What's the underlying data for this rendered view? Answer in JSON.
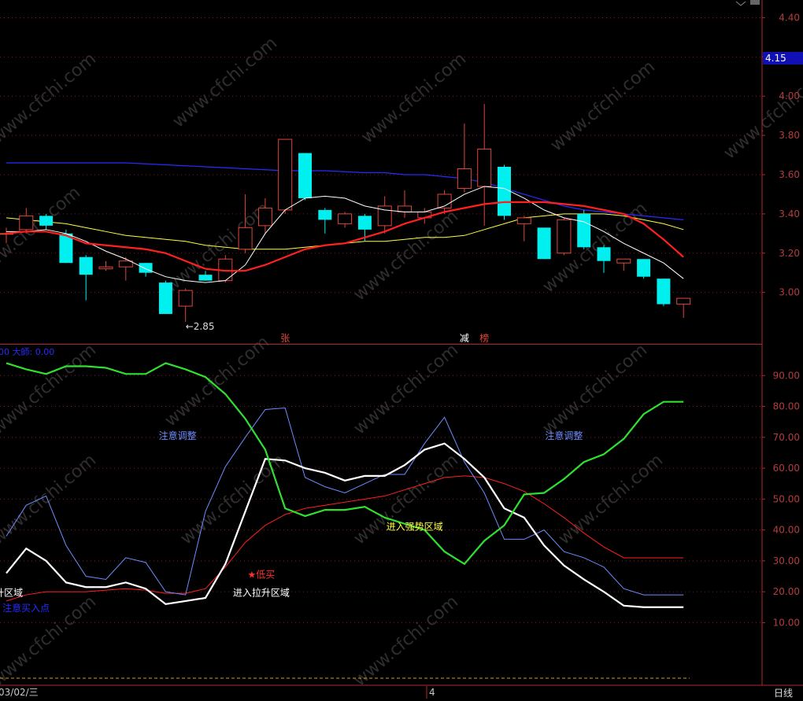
{
  "colors": {
    "up": "#e0463c",
    "down": "#00f0f0",
    "ma5": "#ffffff",
    "ma10": "#ffff40",
    "ma20": "#ff2020",
    "ma60": "#2a2aff",
    "axis": "#b4282d",
    "grid": "#7a1a1a",
    "osc_fast": "#ffffff",
    "osc_blue": "#6e8cff",
    "osc_red": "#ff2020",
    "osc_green": "#30e030"
  },
  "price_panel": {
    "price_marker_label": "4.15",
    "low_annotation": "←2.85",
    "markers": [
      {
        "text": "张",
        "color": "#e0463c",
        "bar": 14
      },
      {
        "text": "减",
        "color": "#ffffff",
        "bar": 23
      },
      {
        "text": "榜",
        "color": "#e0463c",
        "bar": 24
      }
    ]
  },
  "indicator_panel": {
    "header": "00 大師: 0.00",
    "annotations": [
      {
        "text": "注意调整",
        "color": "#6e8cff",
        "bar": 8.6,
        "value": 70.5
      },
      {
        "text": "注意调整",
        "color": "#6e8cff",
        "bar": 28,
        "value": 70.5
      },
      {
        "text": "进入强势区域",
        "color": "#ffff40",
        "bar": 20.5,
        "value": 41
      },
      {
        "text": "★低买",
        "color": "#ff3030",
        "bar": 12.8,
        "value": 25.5
      },
      {
        "text": "进入拉升区域",
        "color": "#ffffff",
        "bar": 12.8,
        "value": 19.7
      },
      {
        "text": "升区域",
        "color": "#ffffff",
        "bar": 0.2,
        "value": 19.7
      },
      {
        "text": "注意买入点",
        "color": "#2a2aff",
        "bar": 0.6,
        "value": 14.7
      }
    ]
  },
  "footer": {
    "date_label": "03/02/三",
    "mid_label": "4",
    "period_label": "日线"
  },
  "watermark": "www.cfchi.com",
  "chart_data": [
    {
      "type": "candlestick",
      "yticks": [
        3.0,
        3.2,
        3.4,
        3.6,
        3.8,
        4.0,
        4.2,
        4.4
      ],
      "ylim": [
        2.77,
        4.49
      ],
      "candles": [
        {
          "o": 3.3,
          "h": 3.33,
          "l": 3.25,
          "c": 3.3
        },
        {
          "o": 3.32,
          "h": 3.43,
          "l": 3.3,
          "c": 3.39
        },
        {
          "o": 3.39,
          "h": 3.4,
          "l": 3.32,
          "c": 3.34
        },
        {
          "o": 3.3,
          "h": 3.32,
          "l": 3.15,
          "c": 3.15
        },
        {
          "o": 3.18,
          "h": 3.19,
          "l": 2.96,
          "c": 3.09
        },
        {
          "o": 3.12,
          "h": 3.16,
          "l": 3.11,
          "c": 3.13
        },
        {
          "o": 3.13,
          "h": 3.18,
          "l": 3.06,
          "c": 3.16
        },
        {
          "o": 3.15,
          "h": 3.15,
          "l": 3.08,
          "c": 3.1
        },
        {
          "o": 3.05,
          "h": 3.06,
          "l": 2.89,
          "c": 2.89
        },
        {
          "o": 2.93,
          "h": 3.02,
          "l": 2.85,
          "c": 3.01
        },
        {
          "o": 3.09,
          "h": 3.11,
          "l": 3.06,
          "c": 3.06
        },
        {
          "o": 3.06,
          "h": 3.19,
          "l": 3.05,
          "c": 3.17
        },
        {
          "o": 3.22,
          "h": 3.5,
          "l": 3.2,
          "c": 3.33
        },
        {
          "o": 3.34,
          "h": 3.48,
          "l": 3.3,
          "c": 3.43
        },
        {
          "o": 3.42,
          "h": 3.78,
          "l": 3.4,
          "c": 3.78
        },
        {
          "o": 3.71,
          "h": 3.71,
          "l": 3.47,
          "c": 3.48
        },
        {
          "o": 3.42,
          "h": 3.43,
          "l": 3.3,
          "c": 3.37
        },
        {
          "o": 3.35,
          "h": 3.41,
          "l": 3.33,
          "c": 3.4
        },
        {
          "o": 3.39,
          "h": 3.4,
          "l": 3.26,
          "c": 3.32
        },
        {
          "o": 3.34,
          "h": 3.49,
          "l": 3.3,
          "c": 3.44
        },
        {
          "o": 3.41,
          "h": 3.52,
          "l": 3.38,
          "c": 3.44
        },
        {
          "o": 3.38,
          "h": 3.43,
          "l": 3.35,
          "c": 3.41
        },
        {
          "o": 3.43,
          "h": 3.52,
          "l": 3.4,
          "c": 3.5
        },
        {
          "o": 3.53,
          "h": 3.86,
          "l": 3.51,
          "c": 3.63
        },
        {
          "o": 3.54,
          "h": 3.96,
          "l": 3.34,
          "c": 3.73
        },
        {
          "o": 3.64,
          "h": 3.65,
          "l": 3.37,
          "c": 3.39
        },
        {
          "o": 3.35,
          "h": 3.39,
          "l": 3.26,
          "c": 3.38
        },
        {
          "o": 3.33,
          "h": 3.33,
          "l": 3.17,
          "c": 3.17
        },
        {
          "o": 3.2,
          "h": 3.38,
          "l": 3.19,
          "c": 3.37
        },
        {
          "o": 3.4,
          "h": 3.42,
          "l": 3.22,
          "c": 3.23
        },
        {
          "o": 3.23,
          "h": 3.24,
          "l": 3.1,
          "c": 3.16
        },
        {
          "o": 3.15,
          "h": 3.17,
          "l": 3.11,
          "c": 3.17
        },
        {
          "o": 3.17,
          "h": 3.17,
          "l": 3.07,
          "c": 3.08
        },
        {
          "o": 3.07,
          "h": 3.07,
          "l": 2.93,
          "c": 2.94
        },
        {
          "o": 2.94,
          "h": 2.97,
          "l": 2.87,
          "c": 2.97
        }
      ],
      "ma5": [
        3.31,
        3.31,
        3.32,
        3.3,
        3.26,
        3.21,
        3.17,
        3.12,
        3.08,
        3.06,
        3.05,
        3.06,
        3.14,
        3.3,
        3.42,
        3.48,
        3.49,
        3.48,
        3.44,
        3.42,
        3.41,
        3.41,
        3.44,
        3.5,
        3.54,
        3.53,
        3.48,
        3.42,
        3.38,
        3.36,
        3.31,
        3.25,
        3.2,
        3.15,
        3.07
      ],
      "ma10": [
        3.38,
        3.37,
        3.36,
        3.35,
        3.33,
        3.31,
        3.29,
        3.28,
        3.27,
        3.26,
        3.24,
        3.23,
        3.22,
        3.22,
        3.22,
        3.23,
        3.24,
        3.25,
        3.26,
        3.26,
        3.27,
        3.28,
        3.28,
        3.29,
        3.32,
        3.35,
        3.38,
        3.39,
        3.4,
        3.4,
        3.4,
        3.39,
        3.37,
        3.35,
        3.32
      ],
      "ma20": [
        3.3,
        3.31,
        3.31,
        3.29,
        3.25,
        3.24,
        3.23,
        3.22,
        3.2,
        3.16,
        3.12,
        3.11,
        3.11,
        3.14,
        3.18,
        3.22,
        3.24,
        3.25,
        3.28,
        3.31,
        3.35,
        3.38,
        3.41,
        3.43,
        3.45,
        3.46,
        3.46,
        3.46,
        3.45,
        3.44,
        3.42,
        3.4,
        3.35,
        3.27,
        3.18
      ],
      "ma60": [
        3.66,
        3.66,
        3.66,
        3.66,
        3.66,
        3.66,
        3.66,
        3.655,
        3.65,
        3.645,
        3.64,
        3.635,
        3.63,
        3.625,
        3.62,
        3.62,
        3.62,
        3.615,
        3.61,
        3.61,
        3.6,
        3.6,
        3.59,
        3.58,
        3.56,
        3.53,
        3.5,
        3.47,
        3.44,
        3.42,
        3.41,
        3.4,
        3.39,
        3.38,
        3.37
      ]
    },
    {
      "type": "line",
      "yticks": [
        10,
        20,
        30,
        40,
        50,
        60,
        70,
        80,
        90
      ],
      "ylim": [
        -9,
        99.5
      ],
      "series": [
        {
          "values": [
            26,
            34,
            30,
            23,
            21.5,
            21.5,
            23,
            21,
            16,
            17,
            18,
            29,
            46,
            63,
            62.5,
            60,
            58.5,
            56,
            57.5,
            57.5,
            61,
            66,
            68,
            63,
            57,
            47,
            44,
            35,
            28.5,
            24,
            20,
            15.5,
            15,
            15,
            15
          ]
        },
        {
          "values": [
            38,
            48,
            51,
            35,
            25,
            24,
            31,
            29.5,
            20,
            19,
            46,
            60.5,
            70,
            79,
            79.5,
            57,
            54,
            52,
            55,
            58,
            58,
            68,
            76.5,
            62,
            52,
            37,
            37,
            40,
            33,
            31,
            28,
            21,
            19,
            19,
            19
          ]
        },
        {
          "values": [
            17,
            19,
            20,
            20,
            20,
            20.5,
            21,
            20.5,
            19.5,
            19.5,
            21,
            28,
            36,
            41.5,
            45,
            47,
            48,
            49,
            50,
            51,
            53,
            55,
            57,
            57.5,
            57,
            55,
            52.5,
            48.5,
            44,
            39,
            34.5,
            31,
            31,
            31,
            31
          ]
        },
        {
          "values": [
            94,
            92,
            90.5,
            93,
            93,
            92.5,
            90.5,
            90.5,
            94,
            92,
            89.5,
            84,
            76,
            66,
            47,
            44.5,
            46.5,
            46.5,
            47.5,
            44,
            42,
            40,
            33,
            29,
            36.5,
            41.5,
            51.5,
            52,
            56.5,
            62,
            64.5,
            69.5,
            77.5,
            81.5,
            81.5
          ]
        }
      ]
    }
  ]
}
